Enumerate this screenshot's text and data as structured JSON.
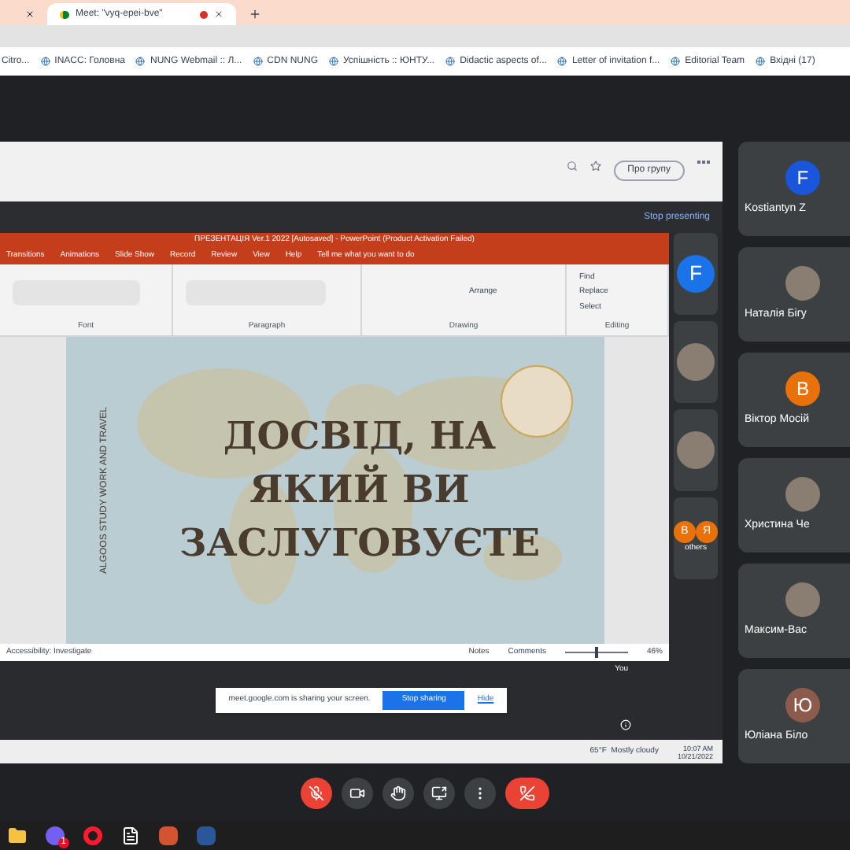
{
  "browser": {
    "tabs": [
      {
        "selected": false
      },
      {
        "title": "Meet: \"vyq-epei-bve\"",
        "selected": true,
        "recording": true
      }
    ],
    "bookmarks": [
      {
        "label": "Citro..."
      },
      {
        "label": "INACC: Головна"
      },
      {
        "label": "NUNG Webmail :: Л..."
      },
      {
        "label": "CDN NUNG"
      },
      {
        "label": "Успішність :: ЮНТУ..."
      },
      {
        "label": "Didactic aspects of..."
      },
      {
        "label": "Letter of invitation f..."
      },
      {
        "label": "Editorial Team"
      },
      {
        "label": "Вхідні (17)"
      }
    ]
  },
  "shared_screen": {
    "group_button": "Про групу",
    "stop_presenting": "Stop presenting",
    "powerpoint": {
      "title": "ПРЕЗЕНТАЦІЯ Ver.1 2022 [Autosaved] - PowerPoint (Product Activation Failed)",
      "tabs": [
        "Transitions",
        "Animations",
        "Slide Show",
        "Record",
        "Review",
        "View",
        "Help"
      ],
      "tell_me": "Tell me what you want to do",
      "groups": [
        "Font",
        "Paragraph",
        "Drawing",
        "Editing"
      ],
      "arrange": "Arrange",
      "editing_items": [
        "Find",
        "Replace",
        "Select"
      ],
      "slide": {
        "title_lines": [
          "ДОСВІД, НА",
          "ЯКИЙ ВИ",
          "ЗАСЛУГОВУЄТЕ"
        ],
        "side_text": "ALGOOS STUDY WORK AND TRAVEL"
      },
      "status": {
        "accessibility": "Accessibility: Investigate",
        "notes": "Notes",
        "comments": "Comments",
        "zoom": {
          "level": 0.5,
          "reading": "46%"
        }
      }
    },
    "tiles": [
      {
        "kind": "letter",
        "letter": "F",
        "color": "#1a73e8"
      },
      {
        "kind": "photo"
      },
      {
        "kind": "photo"
      },
      {
        "kind": "group",
        "letters": [
          "В",
          "Я"
        ],
        "caption": "others"
      }
    ],
    "self_label": "You",
    "notice": {
      "text": "meet.google.com is sharing your screen.",
      "stop": "Stop sharing",
      "hide": "Hide"
    },
    "taskbar": {
      "weather": "65°F  Mostly cloudy",
      "time": "10:07 AM",
      "date": "10/21/2022"
    }
  },
  "participants": [
    {
      "name": "Kostiantyn Z",
      "kind": "letter",
      "letter": "F",
      "color": "#1a56db"
    },
    {
      "name": "Наталія Бігу",
      "kind": "photo"
    },
    {
      "name": "Віктор Мосій",
      "kind": "letter",
      "letter": "B",
      "color": "#e8710a"
    },
    {
      "name": "Христина Че",
      "kind": "photo"
    },
    {
      "name": "Максим-Вас",
      "kind": "photo"
    },
    {
      "name": "Юліана Біло",
      "kind": "letter",
      "letter": "Ю",
      "color": "#8d5b4c"
    }
  ],
  "controls": [
    {
      "kind": "mic",
      "muted": true
    },
    {
      "kind": "camera",
      "muted": false
    },
    {
      "kind": "hand",
      "muted": false
    },
    {
      "kind": "present",
      "muted": false
    },
    {
      "kind": "more",
      "muted": false
    },
    {
      "kind": "leave"
    }
  ],
  "taskbar": [
    {
      "kind": "folder"
    },
    {
      "kind": "viber",
      "badge": "1"
    },
    {
      "kind": "opera"
    },
    {
      "kind": "file"
    },
    {
      "kind": "powerpoint"
    },
    {
      "kind": "word"
    }
  ]
}
